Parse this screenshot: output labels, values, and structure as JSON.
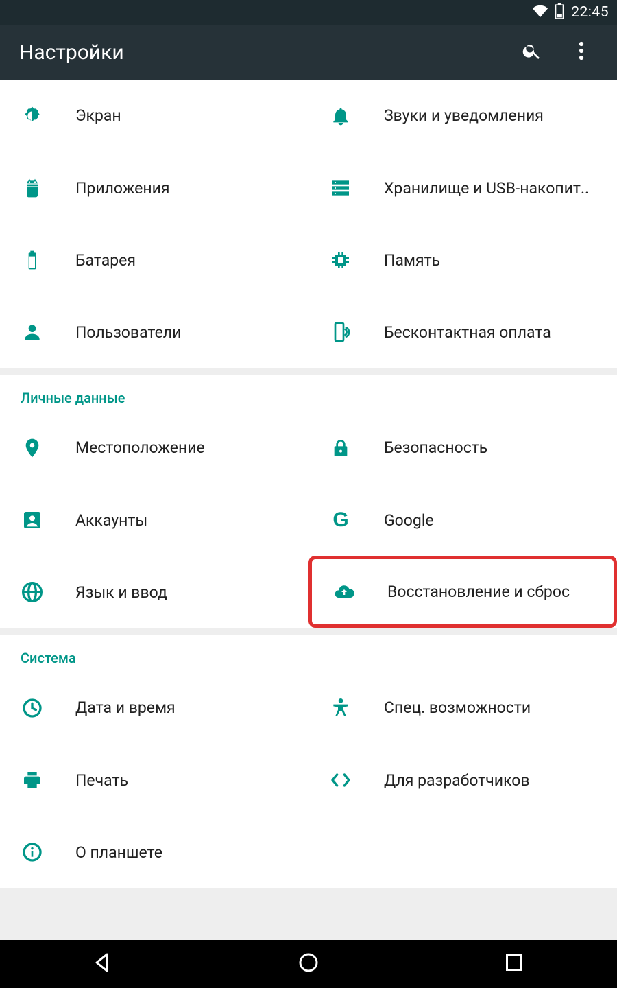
{
  "statusbar": {
    "time": "22:45"
  },
  "appbar": {
    "title": "Настройки"
  },
  "sections": {
    "device": {
      "items": [
        {
          "label": "Экран"
        },
        {
          "label": "Звуки и уведомления"
        },
        {
          "label": "Приложения"
        },
        {
          "label": "Хранилище и USB-накопит.."
        },
        {
          "label": "Батарея"
        },
        {
          "label": "Память"
        },
        {
          "label": "Пользователи"
        },
        {
          "label": "Бесконтактная оплата"
        }
      ]
    },
    "personal": {
      "header": "Личные данные",
      "items": [
        {
          "label": "Местоположение"
        },
        {
          "label": "Безопасность"
        },
        {
          "label": "Аккаунты"
        },
        {
          "label": "Google"
        },
        {
          "label": "Язык и ввод"
        },
        {
          "label": "Восстановление и сброс"
        }
      ]
    },
    "system": {
      "header": "Система",
      "items": [
        {
          "label": "Дата и время"
        },
        {
          "label": "Спец. возможности"
        },
        {
          "label": "Печать"
        },
        {
          "label": "Для разработчиков"
        },
        {
          "label": "О планшете"
        }
      ]
    }
  }
}
